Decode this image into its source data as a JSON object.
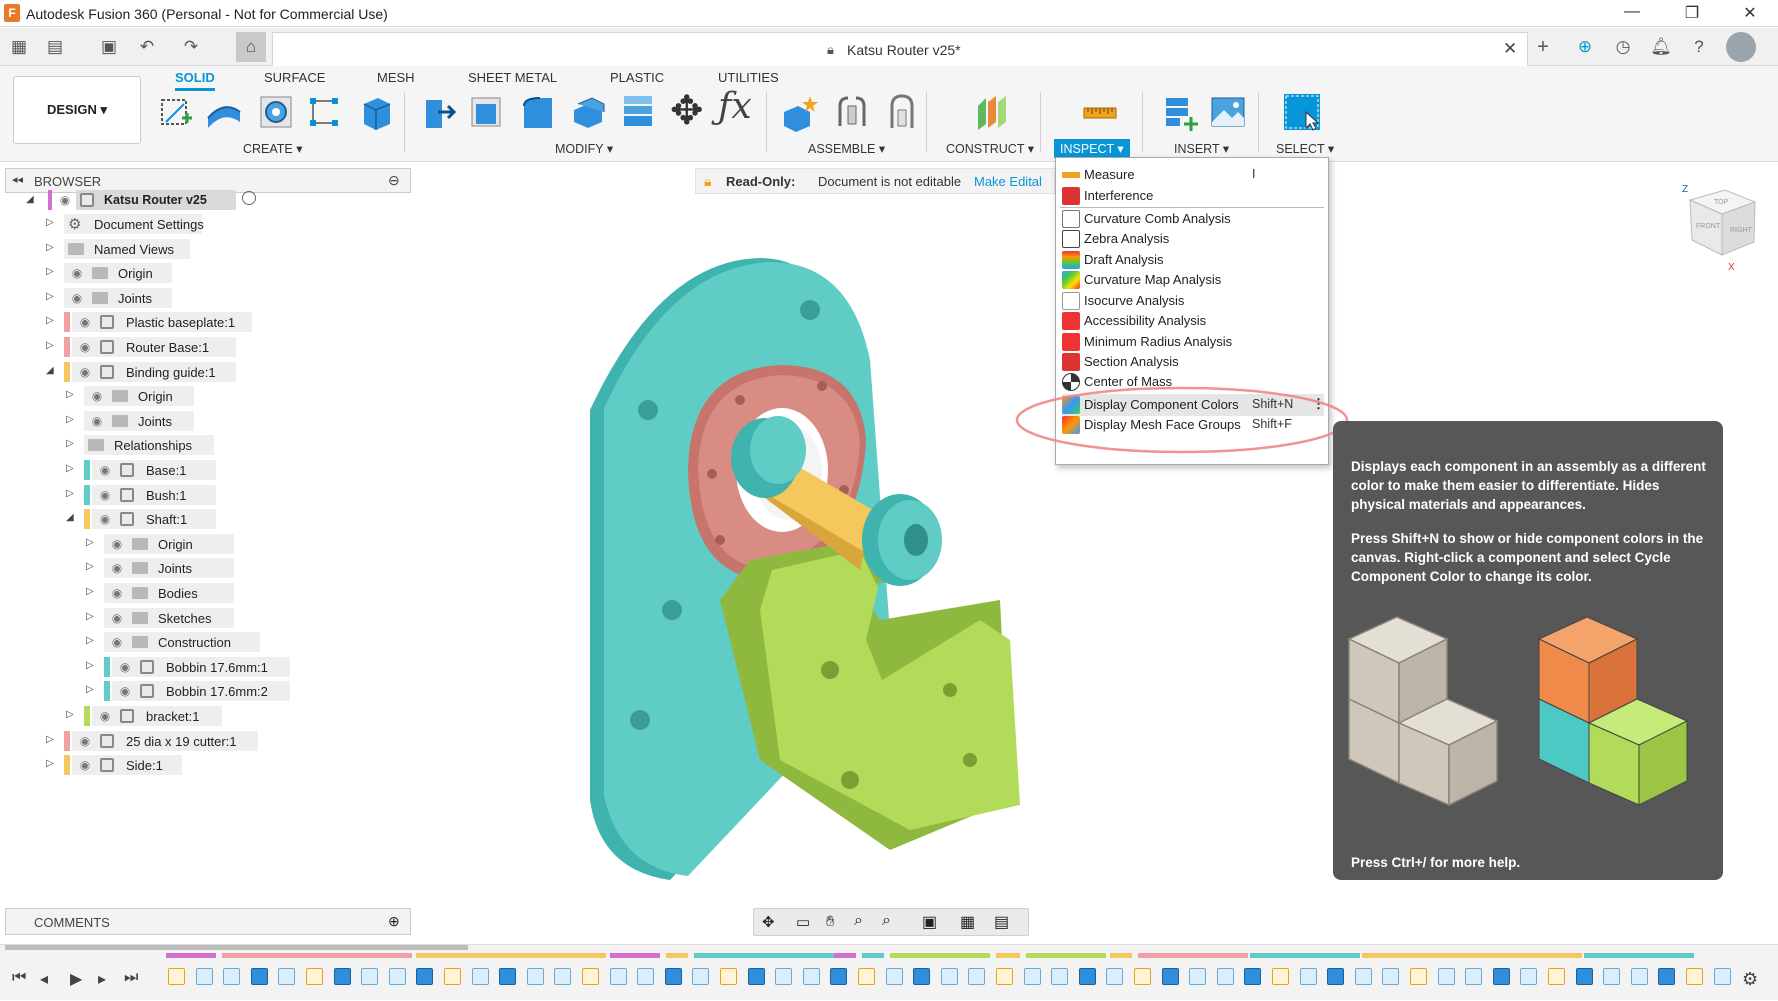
{
  "app": {
    "title": "Autodesk Fusion 360 (Personal - Not for Commercial Use)",
    "logo_letter": "F",
    "window_controls": [
      "—",
      "❐",
      "✕"
    ]
  },
  "document": {
    "tab_name": "Katsu Router v25*"
  },
  "ribbon": {
    "workspace": "DESIGN ▾",
    "tabs": [
      "SOLID",
      "SURFACE",
      "MESH",
      "SHEET METAL",
      "PLASTIC",
      "UTILITIES"
    ],
    "groups": {
      "create": "CREATE ▾",
      "modify": "MODIFY ▾",
      "assemble": "ASSEMBLE ▾",
      "construct": "CONSTRUCT ▾",
      "inspect": "INSPECT ▾",
      "insert": "INSERT ▾",
      "select": "SELECT ▾"
    }
  },
  "readonly_banner": {
    "label": "Read-Only:",
    "message": "Document is not editable",
    "action": "Make Edital"
  },
  "browser": {
    "title": "BROWSER",
    "root": "Katsu Router v25",
    "items": [
      {
        "label": "Document Settings"
      },
      {
        "label": "Named Views"
      },
      {
        "label": "Origin"
      },
      {
        "label": "Joints"
      },
      {
        "label": "Plastic baseplate:1"
      },
      {
        "label": "Router Base:1"
      },
      {
        "label": "Binding guide:1"
      },
      {
        "label": "Origin"
      },
      {
        "label": "Joints"
      },
      {
        "label": "Relationships"
      },
      {
        "label": "Base:1"
      },
      {
        "label": "Bush:1"
      },
      {
        "label": "Shaft:1"
      },
      {
        "label": "Origin"
      },
      {
        "label": "Joints"
      },
      {
        "label": "Bodies"
      },
      {
        "label": "Sketches"
      },
      {
        "label": "Construction"
      },
      {
        "label": "Bobbin 17.6mm:1"
      },
      {
        "label": "Bobbin 17.6mm:2"
      },
      {
        "label": "bracket:1"
      },
      {
        "label": "25 dia x 19 cutter:1"
      },
      {
        "label": "Side:1"
      }
    ]
  },
  "comments": {
    "title": "COMMENTS"
  },
  "inspect_menu": {
    "items": [
      {
        "label": "Measure",
        "shortcut": "I"
      },
      {
        "label": "Interference",
        "shortcut": ""
      },
      {
        "label": "Curvature Comb Analysis",
        "shortcut": ""
      },
      {
        "label": "Zebra Analysis",
        "shortcut": ""
      },
      {
        "label": "Draft Analysis",
        "shortcut": ""
      },
      {
        "label": "Curvature Map Analysis",
        "shortcut": ""
      },
      {
        "label": "Isocurve Analysis",
        "shortcut": ""
      },
      {
        "label": "Accessibility Analysis",
        "shortcut": ""
      },
      {
        "label": "Minimum Radius Analysis",
        "shortcut": ""
      },
      {
        "label": "Section Analysis",
        "shortcut": ""
      },
      {
        "label": "Center of Mass",
        "shortcut": ""
      },
      {
        "label": "Display Component Colors",
        "shortcut": "Shift+N"
      },
      {
        "label": "Display Mesh Face Groups",
        "shortcut": "Shift+F"
      }
    ]
  },
  "tooltip": {
    "para1": "Displays each component in an assembly as a different color to make them easier to differentiate. Hides physical materials and appearances.",
    "para2": "Press Shift+N to show or hide component colors in the canvas. Right-click a component and select Cycle Component Color to change its color.",
    "footer": "Press Ctrl+/ for more help."
  },
  "viewcube": {
    "top": "TOP",
    "front": "FRONT",
    "right": "RIGHT",
    "z": "Z",
    "x": "X"
  },
  "colors": {
    "accent": "#0696d7",
    "teal": "#5fcdc6",
    "salmon": "#d98c83",
    "lime": "#b2db5a",
    "yellow": "#f4c85c"
  }
}
